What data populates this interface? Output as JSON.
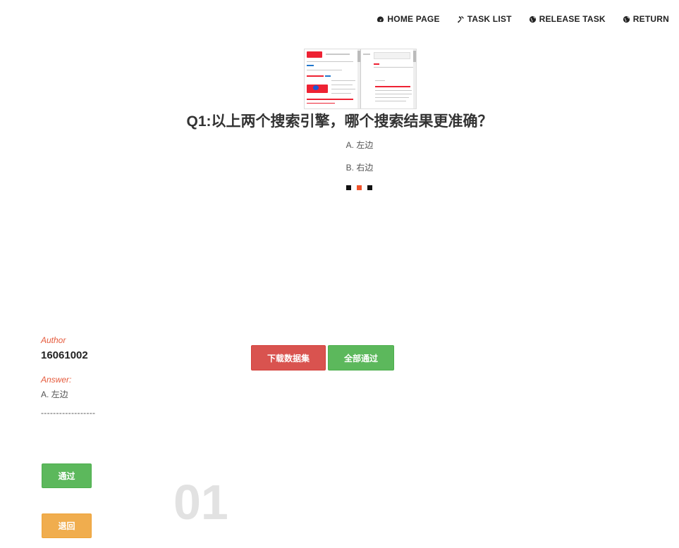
{
  "nav": {
    "items": [
      {
        "label": "HOME PAGE",
        "icon": "dashboard-icon"
      },
      {
        "label": "TASK LIST",
        "icon": "gavel-icon"
      },
      {
        "label": "RELEASE TASK",
        "icon": "globe-icon"
      },
      {
        "label": "RETURN",
        "icon": "globe-icon"
      }
    ]
  },
  "question": {
    "title": "Q1:以上两个搜索引擎，哪个搜索结果更准确？",
    "options": [
      "A. 左边",
      "B. 右边"
    ],
    "image": "search-engine-comparison-screenshot"
  },
  "carousel": {
    "count": 3,
    "active_index": 1
  },
  "author": {
    "label": "Author",
    "value": "16061002"
  },
  "answer": {
    "label": "Answer:",
    "value": "A. 左边",
    "divider": "------------------"
  },
  "actions": {
    "download_label": "下载数据集",
    "pass_all_label": "全部通过",
    "pass_label": "通过",
    "return_label": "退回"
  },
  "page_number": "01",
  "colors": {
    "accent": "#f0522a",
    "danger": "#d9534f",
    "success": "#5cb85c",
    "warning": "#f0ad4e"
  }
}
